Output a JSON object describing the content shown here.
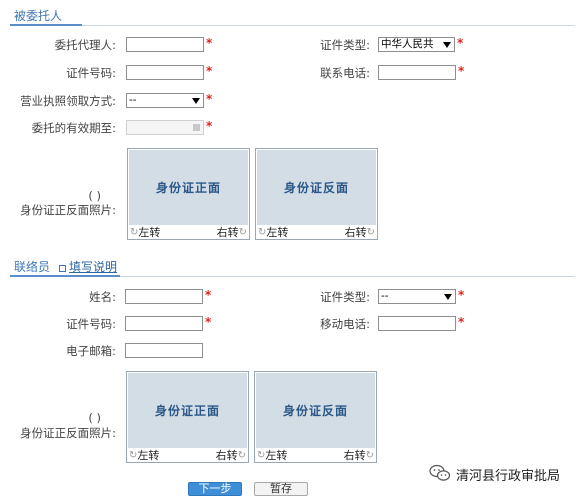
{
  "trustee_section": {
    "title": "被委托人",
    "agent_label": "委托代理人:",
    "agent_value": "",
    "cert_type_label": "证件类型:",
    "cert_type_value": "中华人民共",
    "cert_no_label": "证件号码:",
    "cert_no_value": "",
    "phone_label": "联系电话:",
    "phone_value": "",
    "license_method_label": "营业执照领取方式:",
    "license_method_value": "--",
    "valid_until_label": "委托的有效期至:",
    "valid_until_value": "",
    "id_photo_label_line1": "( )",
    "id_photo_label_line2": "身份证正反面照片:",
    "photo_front": "身份证正面",
    "photo_back": "身份证反面",
    "rotate_left": "左转",
    "rotate_right": "右转"
  },
  "contact_section": {
    "title": "联络员",
    "help_link": "填写说明",
    "name_label": "姓名:",
    "name_value": "",
    "cert_type_label": "证件类型:",
    "cert_type_value": "--",
    "cert_no_label": "证件号码:",
    "cert_no_value": "",
    "mobile_label": "移动电话:",
    "mobile_value": "",
    "email_label": "电子邮箱:",
    "email_value": "",
    "id_photo_label_line1": "( )",
    "id_photo_label_line2": "身份证正反面照片:",
    "photo_front": "身份证正面",
    "photo_back": "身份证反面",
    "rotate_left": "左转",
    "rotate_right": "右转"
  },
  "actions": {
    "next_label": "下一步",
    "save_label": "暂存"
  },
  "required_mark": "*",
  "watermark": {
    "text": "清河县行政审批局",
    "icon": "wechat-icon"
  },
  "colors": {
    "section_title": "#3d78b4",
    "required": "#e0241c",
    "next_button": "#3e8fd7",
    "photo_bg": "#d3dde6",
    "photo_text": "#2a5788"
  }
}
